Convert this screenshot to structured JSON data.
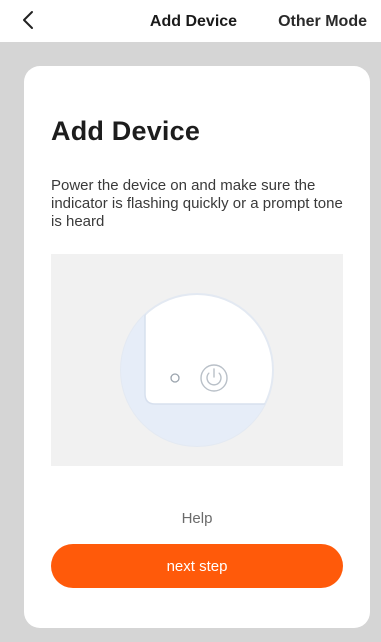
{
  "header": {
    "title": "Add Device",
    "other_mode_label": "Other Mode",
    "back_icon": "chevron-left-icon"
  },
  "card": {
    "title": "Add Device",
    "description": "Power the device on and make sure the indicator is flashing quickly or a prompt tone is heard",
    "illustration_icons": [
      "indicator-light-icon",
      "power-icon"
    ],
    "help_label": "Help",
    "next_button_label": "next step"
  },
  "colors": {
    "accent": "#ff5a0a",
    "page_background": "#d5d5d5",
    "card_background": "#ffffff"
  }
}
